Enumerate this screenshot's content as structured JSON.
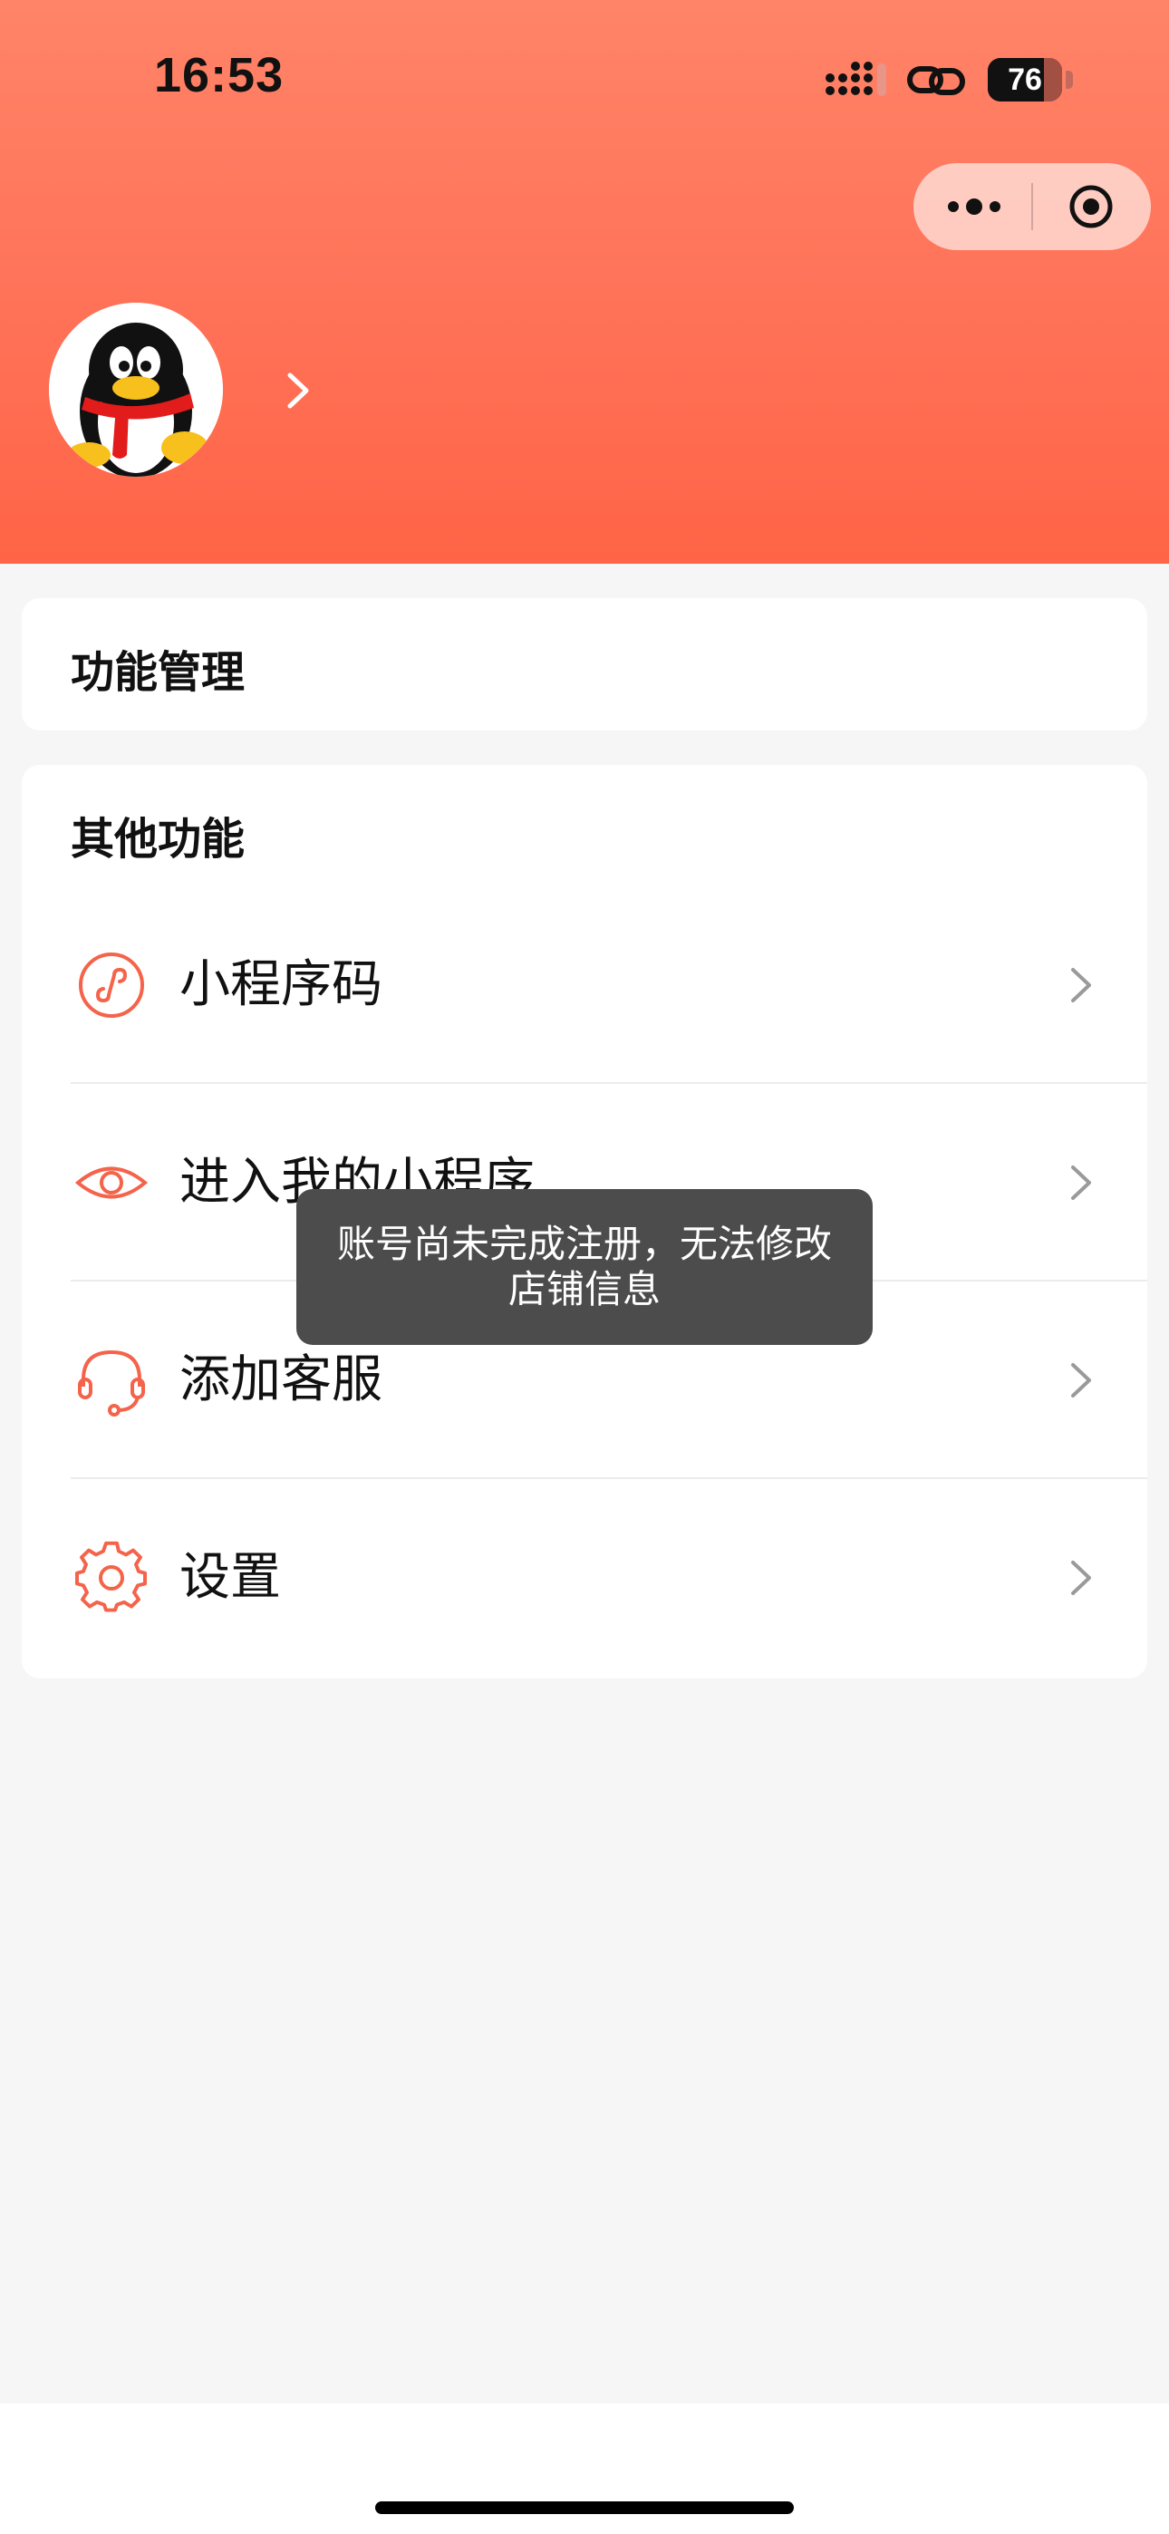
{
  "status_bar": {
    "time": "16:53",
    "battery": "76",
    "icons": [
      "signal-icon",
      "link-icon",
      "battery-icon"
    ]
  },
  "capsule": {
    "icons": [
      "more-dots-icon",
      "close-target-icon"
    ]
  },
  "profile": {
    "avatar": "qq-penguin-avatar",
    "arrow_icon": "chevron-right-icon"
  },
  "sections": {
    "function_management": {
      "title": "功能管理"
    },
    "other_functions": {
      "title": "其他功能",
      "items": [
        {
          "label": "小程序码",
          "icon": "miniprogram-code-icon"
        },
        {
          "label": "进入我的小程序",
          "icon": "eye-icon"
        },
        {
          "label": "添加客服",
          "icon": "headset-icon"
        },
        {
          "label": "设置",
          "icon": "gear-icon"
        }
      ]
    }
  },
  "toast": {
    "message": "账号尚未完成注册，无法修改店铺信息"
  },
  "colors": {
    "header_top": "#ff8468",
    "header_bottom": "#ff6446",
    "accent": "#f4634a",
    "background": "#f6f6f6",
    "toast_bg": "#4c4c4c"
  }
}
